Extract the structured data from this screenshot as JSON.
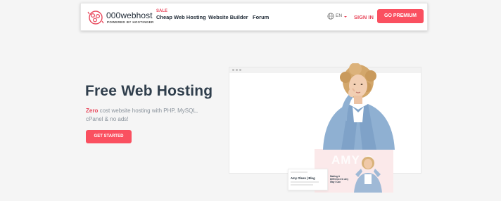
{
  "brand": {
    "name": "000webhost",
    "tagline": "POWERED BY HOSTINGER"
  },
  "nav": {
    "sale_badge": "SALE",
    "items": [
      {
        "label": "Cheap Web Hosting"
      },
      {
        "label": "Website Builder"
      },
      {
        "label": "Forum"
      }
    ],
    "language": "EN",
    "signin_label": "SIGN IN",
    "premium_label": "GO PREMIUM"
  },
  "hero": {
    "title": "Free Web Hosting",
    "subtitle_highlight": "Zero",
    "subtitle_rest": " cost website hosting with PHP, MySQL, cPanel & no ads!",
    "cta_label": "GET STARTED"
  },
  "preview": {
    "big_name": "AMY O",
    "card_title": "Amy Olsen | Blog",
    "card_blurb": "Making A Difference In Any Way I Can"
  },
  "colors": {
    "accent": "#fa5060",
    "text_dark": "#2f3e4c",
    "text_muted": "#8a939c",
    "background": "#f5f5f5"
  }
}
